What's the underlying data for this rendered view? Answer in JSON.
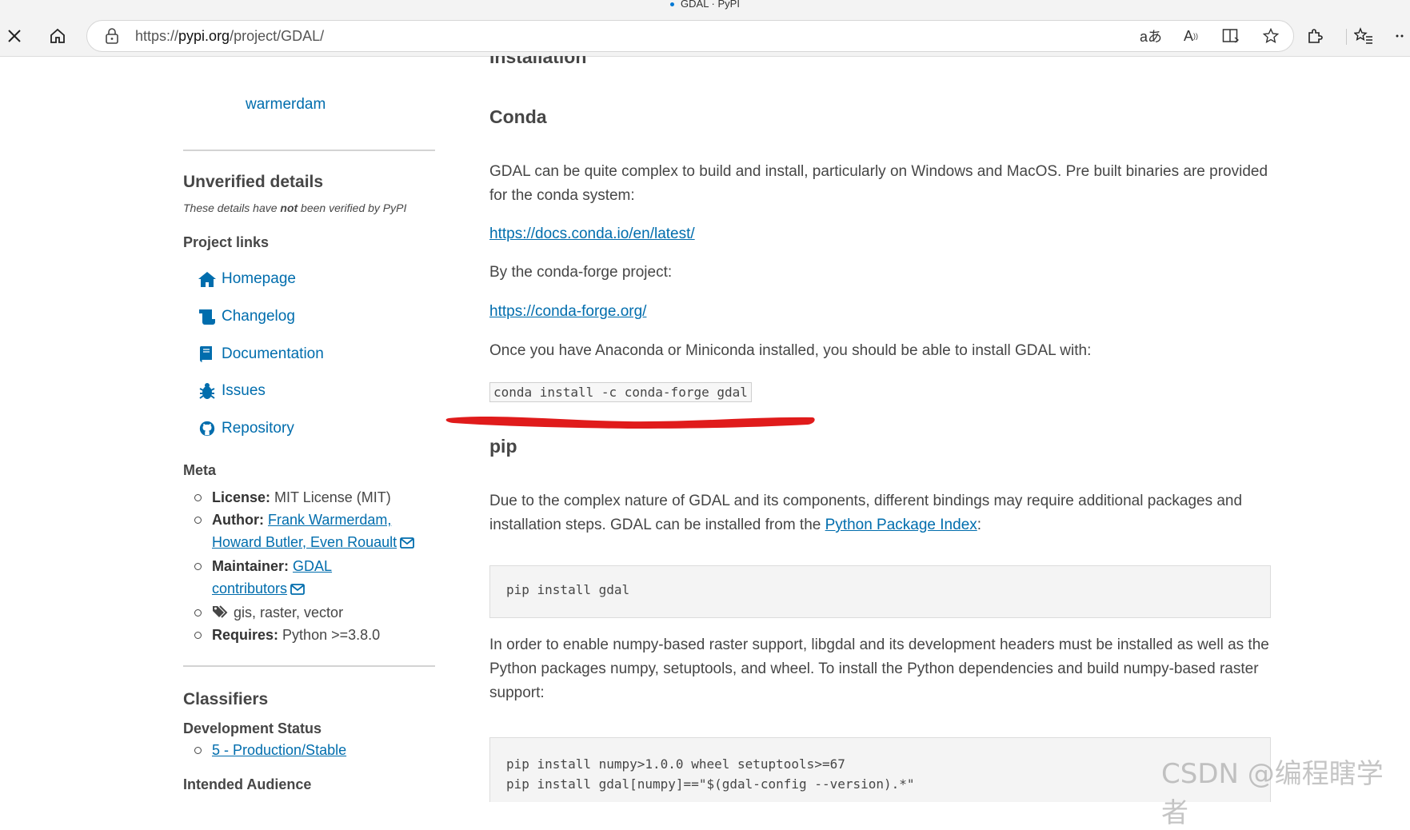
{
  "browser": {
    "tab_title": "GDAL · PyPI",
    "url_prefix": "https://",
    "url_domain": "pypi.org",
    "url_path": "/project/GDAL/"
  },
  "sidebar": {
    "maintainer_name": "warmerdam",
    "unverified_title": "Unverified details",
    "unverified_note_pre": "These details have ",
    "unverified_note_bold": "not",
    "unverified_note_post": " been verified by PyPI",
    "project_links_title": "Project links",
    "links": [
      {
        "label": "Homepage",
        "icon": "home-icon"
      },
      {
        "label": "Changelog",
        "icon": "scroll-icon"
      },
      {
        "label": "Documentation",
        "icon": "book-icon"
      },
      {
        "label": "Issues",
        "icon": "bug-icon"
      },
      {
        "label": "Repository",
        "icon": "github-icon"
      }
    ],
    "meta_title": "Meta",
    "meta": {
      "license_label": "License:",
      "license_value": "MIT License (MIT)",
      "author_label": "Author:",
      "author_link_1": "Frank Warmerdam,",
      "author_link_2": "Howard Butler, Even Rouault",
      "maintainer_label": "Maintainer:",
      "maintainer_link_1": "GDAL",
      "maintainer_link_2": "contributors",
      "tags": "gis, raster, vector",
      "requires_label": "Requires:",
      "requires_value": "Python >=3.8.0"
    },
    "classifiers_title": "Classifiers",
    "dev_status_title": "Development Status",
    "dev_status_value": "5 - Production/Stable",
    "intended_audience_title": "Intended Audience"
  },
  "main": {
    "installation_heading": "Installation",
    "conda_heading": "Conda",
    "conda_para_line1": "GDAL can be quite complex to build and install, particularly on Windows and MacOS. Pre built binaries are provided",
    "conda_para_line2": "for the conda system:",
    "conda_docs_link": "https://docs.conda.io/en/latest/",
    "conda_forge_para": "By the conda-forge project:",
    "conda_forge_link": "https://conda-forge.org/",
    "anaconda_para": "Once you have Anaconda or Miniconda installed, you should be able to install GDAL with:",
    "conda_cmd": "conda install -c conda-forge gdal",
    "pip_heading": "pip",
    "pip_para_line1": "Due to the complex nature of GDAL and its components, different bindings may require additional packages and",
    "pip_para_line2_pre": "installation steps. GDAL can be installed from the ",
    "pip_para_link": "Python Package Index",
    "pip_para_line2_post": ":",
    "pip_cmd": "pip install gdal",
    "numpy_para_line1": "In order to enable numpy-based raster support, libgdal and its development headers must be installed as well as the",
    "numpy_para_line2": "Python packages numpy, setuptools, and wheel. To install the Python dependencies and build numpy-based raster",
    "numpy_para_line3": "support:",
    "numpy_cmd_line1": "pip install numpy>1.0.0 wheel setuptools>=67",
    "numpy_cmd_line2": "pip install gdal[numpy]==\"$(gdal-config --version).*\""
  },
  "watermark": "CSDN @编程瞎学者"
}
